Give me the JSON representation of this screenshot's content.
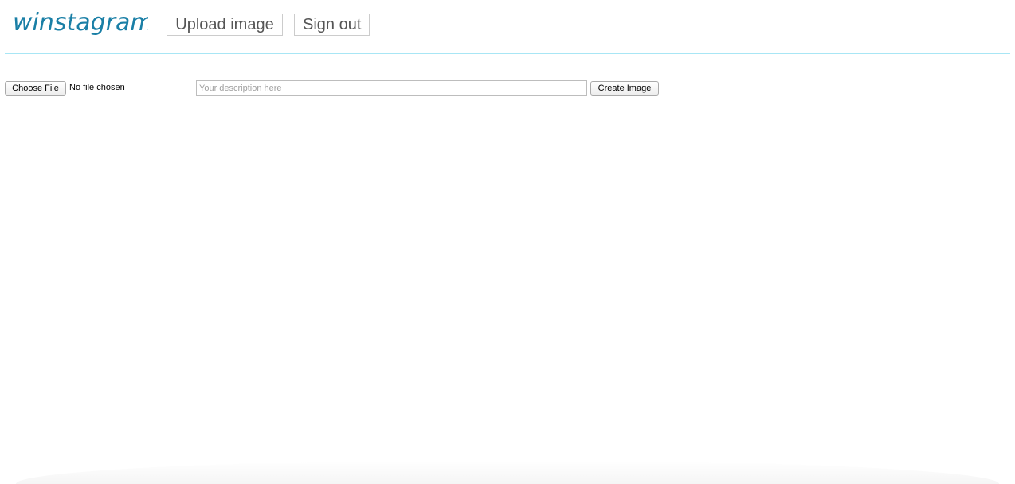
{
  "header": {
    "logo_text": "winstagram",
    "nav": {
      "upload_label": "Upload image",
      "signout_label": "Sign out"
    },
    "colors": {
      "logo": "#1a7fa6",
      "divider": "#a8e6f5"
    }
  },
  "upload_form": {
    "file_button_label": "Choose File",
    "file_status": "No file chosen",
    "description": {
      "value": "",
      "placeholder": "Your description here"
    },
    "submit_label": "Create Image"
  }
}
